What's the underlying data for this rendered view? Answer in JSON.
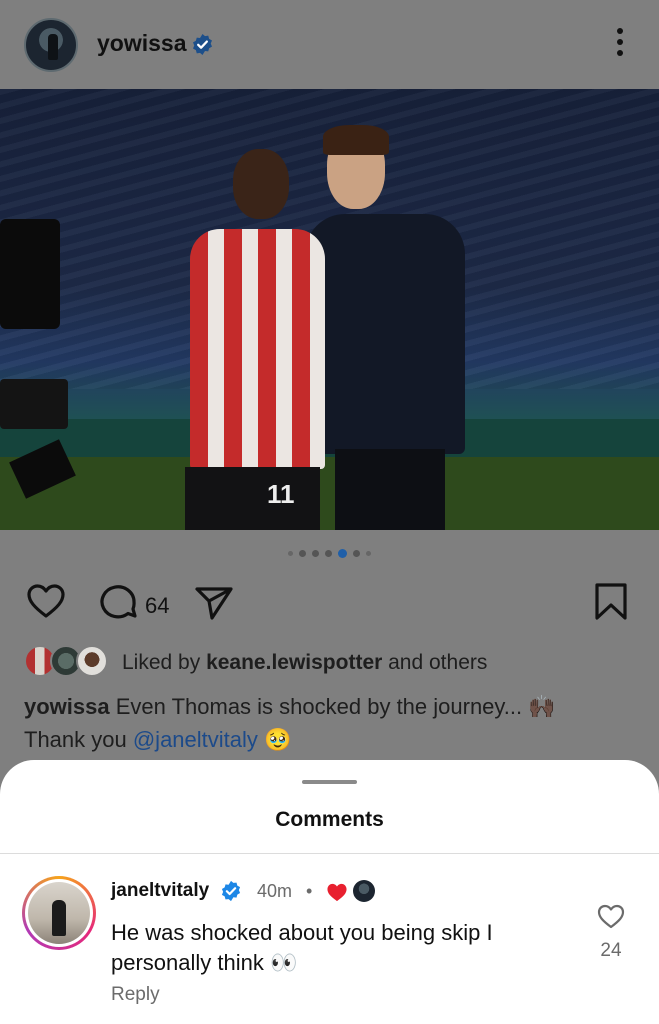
{
  "post": {
    "username": "yowissa",
    "comment_count": "64",
    "carousel": {
      "count": 7,
      "active_index": 5
    },
    "liked_prefix": "Liked by ",
    "liked_user": "keane.lewispotter",
    "liked_suffix": " and others",
    "caption_user": "yowissa",
    "caption_text": " Even Thomas is shocked by the journey... ",
    "caption_emoji": "🙌🏿",
    "caption_line2_prefix": "Thank you ",
    "caption_mention": "@janeltvitaly",
    "caption_line2_emoji": " 🥹",
    "photo_jersey_number": "11"
  },
  "comments_sheet": {
    "title": "Comments",
    "comments": [
      {
        "username": "janeltvitaly",
        "time": "40m",
        "separator": "•",
        "text": "He was shocked about you being skip I personally think 👀",
        "reply_label": "Reply",
        "like_count": "24"
      }
    ]
  },
  "icons": {
    "verified": "verified-badge-icon",
    "more": "more-vertical-icon",
    "like": "heart-outline-icon",
    "comment": "comment-bubble-icon",
    "share": "paper-plane-icon",
    "save": "bookmark-icon",
    "creator_like": "heart-filled-icon"
  },
  "colors": {
    "verified": "#1d87e6",
    "mention": "#1c4a8a",
    "creator_heart": "#e8202f",
    "carousel_active": "#1f5fa8"
  }
}
